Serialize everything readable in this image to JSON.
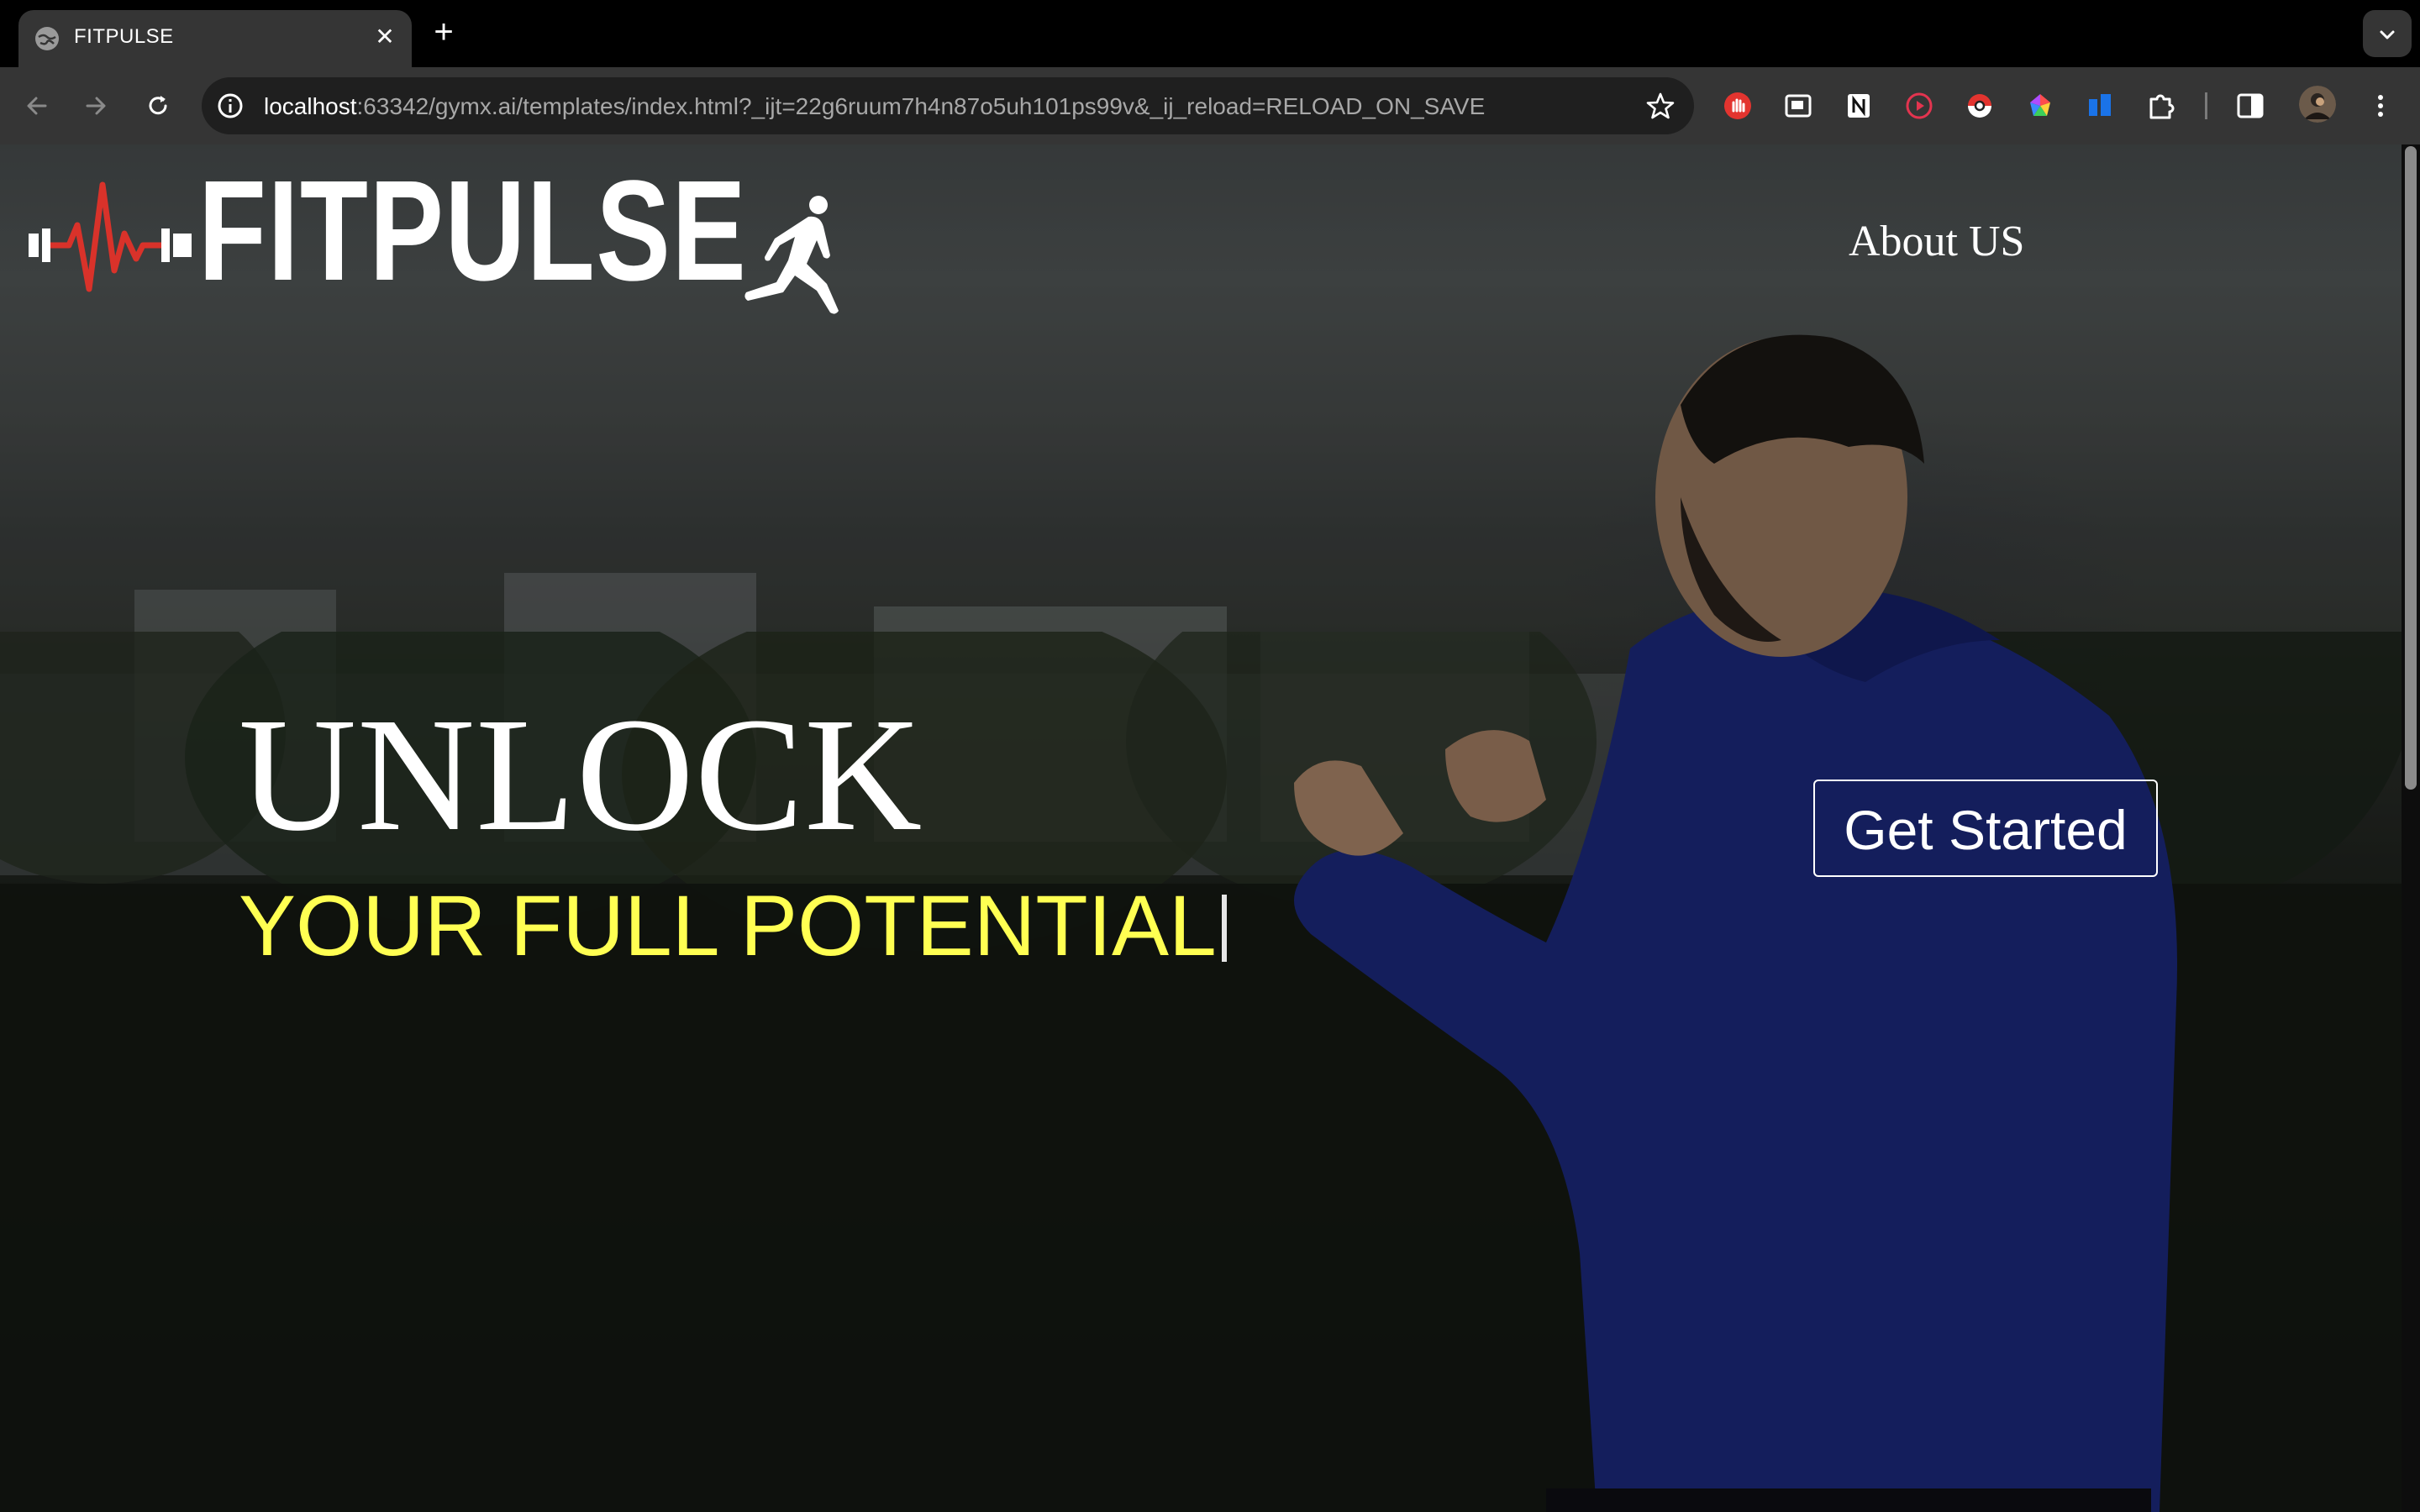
{
  "browser": {
    "tab": {
      "title": "FITPULSE",
      "close_glyph": "✕"
    },
    "new_tab_glyph": "+",
    "url": {
      "host": "localhost",
      "rest": ":63342/gymx.ai/templates/index.html?_ijt=22g6ruum7h4n87o5uh101ps99v&_ij_reload=RELOAD_ON_SAVE"
    },
    "extensions": [
      "stop-extension-icon",
      "picture-in-picture-icon",
      "notion-icon",
      "record-icon",
      "pokeball-icon",
      "color-picker-icon",
      "tab-manager-icon",
      "puzzle-extensions-icon",
      "side-panel-icon",
      "profile-avatar"
    ]
  },
  "page": {
    "logo": {
      "brand": "FITPULSE"
    },
    "nav": {
      "about": "About US"
    },
    "hero": {
      "title": "UNLOCK",
      "subtitle": "YOUR FULL POTENTIAL",
      "cta": "Get Started"
    }
  },
  "colors": {
    "accent_yellow": "#ffff52",
    "pulse_red": "#d9322a",
    "hoodie_blue": "#1d2a80"
  }
}
